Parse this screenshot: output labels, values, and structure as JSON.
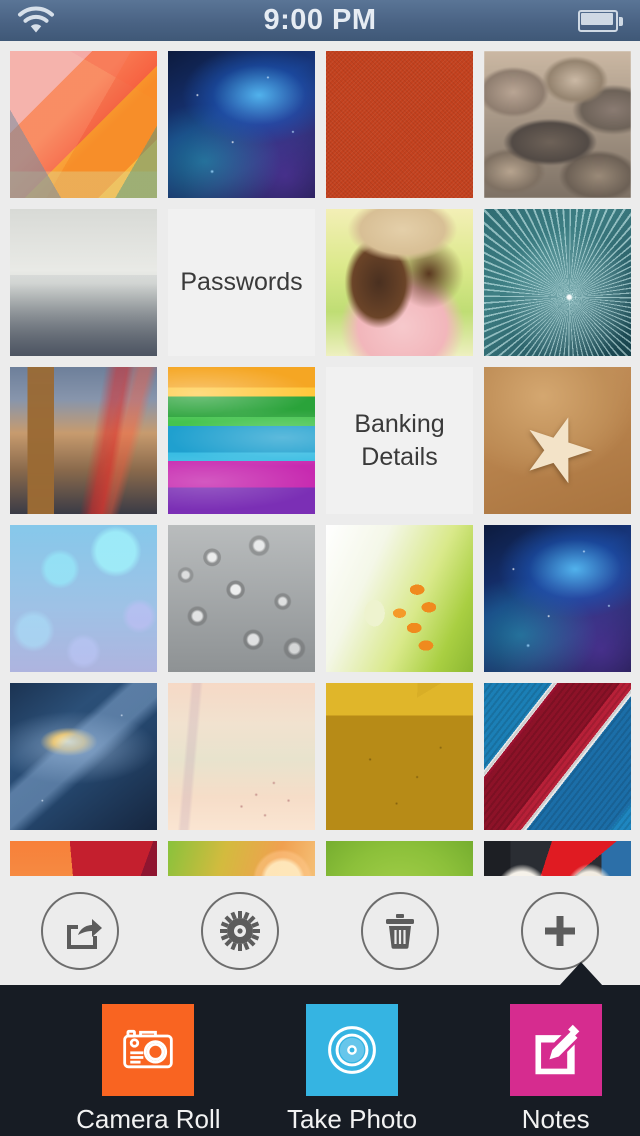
{
  "status_bar": {
    "time": "9:00 PM",
    "wifi_icon": "wifi-icon",
    "battery_icon": "battery-icon"
  },
  "gallery": {
    "tiles": [
      {
        "kind": "image",
        "art": "art-hex",
        "name": "tile-geometric-hexagons"
      },
      {
        "kind": "image",
        "art": "art-nebula",
        "name": "tile-blue-nebula"
      },
      {
        "kind": "image",
        "art": "art-redleather",
        "name": "tile-red-texture"
      },
      {
        "kind": "image",
        "art": "art-pebbles",
        "name": "tile-pebbles"
      },
      {
        "kind": "image",
        "art": "art-road",
        "name": "tile-foggy-road"
      },
      {
        "kind": "text",
        "label": "Passwords",
        "name": "tile-passwords"
      },
      {
        "kind": "image",
        "art": "art-girl",
        "name": "tile-woman-in-hat"
      },
      {
        "kind": "image",
        "art": "art-dandelion",
        "name": "tile-teal-dandelion"
      },
      {
        "kind": "image",
        "art": "art-bigben",
        "name": "tile-big-ben-london"
      },
      {
        "kind": "image",
        "art": "art-waves",
        "name": "tile-color-waves"
      },
      {
        "kind": "text",
        "label": "Banking\nDetails",
        "name": "tile-banking-details"
      },
      {
        "kind": "image",
        "art": "art-starfish",
        "name": "tile-starfish-sand"
      },
      {
        "kind": "image",
        "art": "art-bokeh",
        "name": "tile-blue-bokeh"
      },
      {
        "kind": "image",
        "art": "art-drops",
        "name": "tile-water-droplets"
      },
      {
        "kind": "image",
        "art": "art-lily",
        "name": "tile-lily-flower"
      },
      {
        "kind": "image",
        "art": "art-nebula",
        "name": "tile-blue-nebula-2"
      },
      {
        "kind": "image",
        "art": "art-galaxy",
        "name": "tile-galaxy"
      },
      {
        "kind": "image",
        "art": "art-sky",
        "name": "tile-pastel-sky"
      },
      {
        "kind": "image",
        "art": "art-paint",
        "name": "tile-yellow-peeling-paint"
      },
      {
        "kind": "image",
        "art": "art-stripes",
        "name": "tile-red-blue-stripes"
      },
      {
        "kind": "image",
        "art": "art-orangegeo",
        "name": "tile-orange-geometric"
      },
      {
        "kind": "image",
        "art": "art-sunset",
        "name": "tile-sunset-flare"
      },
      {
        "kind": "image",
        "art": "art-green",
        "name": "tile-green-gradient"
      },
      {
        "kind": "image",
        "art": "art-redwhite",
        "name": "tile-red-white-pattern"
      }
    ]
  },
  "toolbar": {
    "buttons": [
      {
        "name": "share-button",
        "icon": "share-icon"
      },
      {
        "name": "settings-button",
        "icon": "gear-icon"
      },
      {
        "name": "delete-button",
        "icon": "trash-icon"
      },
      {
        "name": "add-button",
        "icon": "plus-icon"
      }
    ]
  },
  "add_sheet": {
    "options": [
      {
        "label": "Camera Roll",
        "icon": "camera-icon",
        "color": "#F96421"
      },
      {
        "label": "Take Photo",
        "icon": "camera-lens-icon",
        "color": "#35B4E2"
      },
      {
        "label": "Notes",
        "icon": "pencil-edit-icon",
        "color": "#D62C8F"
      }
    ]
  },
  "colors": {
    "status_bar": "#4a6384",
    "background": "#ececec",
    "sheet": "#171C24",
    "camera_roll": "#F96421",
    "take_photo": "#35B4E2",
    "notes": "#D62C8F"
  }
}
